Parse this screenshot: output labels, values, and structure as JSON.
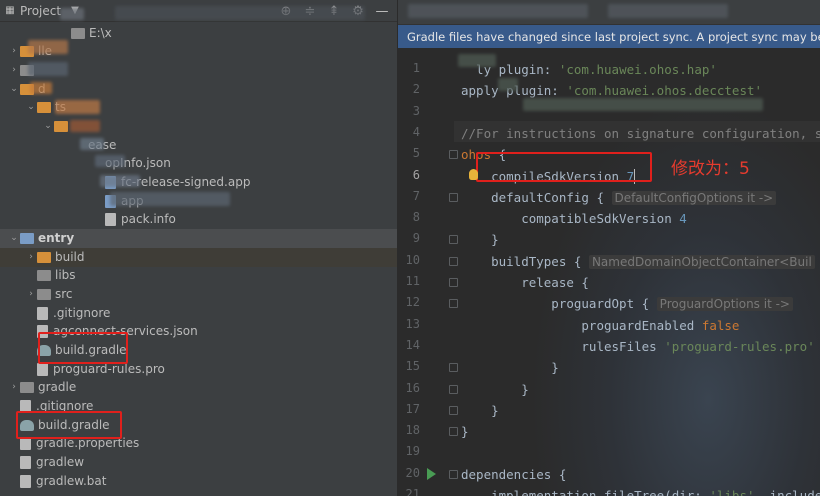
{
  "project_panel": {
    "title": "Project",
    "tools": [
      {
        "name": "locate-icon",
        "glyph": "⊕"
      },
      {
        "name": "expand-all-icon",
        "glyph": "≑"
      },
      {
        "name": "collapse-all-icon",
        "glyph": "⇞"
      },
      {
        "name": "gear-icon",
        "glyph": "⚙"
      },
      {
        "name": "hide-icon",
        "glyph": "—"
      }
    ],
    "tree": [
      {
        "label": "E:\\x",
        "arrow": "",
        "icon": "folder",
        "depth": 3
      },
      {
        "label": "lle",
        "arrow": "›",
        "icon": "folder-orange",
        "depth": 0
      },
      {
        "label": "",
        "arrow": "›",
        "icon": "folder",
        "depth": 0
      },
      {
        "label": "d",
        "arrow": "⌄",
        "icon": "folder-orange",
        "depth": 0
      },
      {
        "label": "ts",
        "arrow": "⌄",
        "icon": "folder-orange",
        "depth": 1
      },
      {
        "label": "",
        "arrow": "⌄",
        "icon": "folder-orange",
        "depth": 2
      },
      {
        "label": "ease",
        "arrow": "",
        "icon": "none",
        "depth": 4
      },
      {
        "label": "opInfo.json",
        "arrow": "",
        "icon": "none",
        "depth": 5
      },
      {
        "label": "fc-release-signed.app",
        "arrow": "",
        "icon": "app",
        "depth": 5
      },
      {
        "label": "app",
        "arrow": "",
        "icon": "app",
        "depth": 5
      },
      {
        "label": "pack.info",
        "arrow": "",
        "icon": "file",
        "depth": 5
      },
      {
        "label": "entry",
        "arrow": "⌄",
        "icon": "folder-blue",
        "depth": 0,
        "bold": true
      },
      {
        "label": "build",
        "arrow": "›",
        "icon": "folder-orange",
        "depth": 1
      },
      {
        "label": "libs",
        "arrow": "",
        "icon": "folder",
        "depth": 1
      },
      {
        "label": "src",
        "arrow": "›",
        "icon": "folder",
        "depth": 1
      },
      {
        "label": ".gitignore",
        "arrow": "",
        "icon": "file",
        "depth": 1
      },
      {
        "label": "agconnect-services.json",
        "arrow": "",
        "icon": "file",
        "depth": 1
      },
      {
        "label": "build.gradle",
        "arrow": "",
        "icon": "gradle",
        "depth": 1
      },
      {
        "label": "proguard-rules.pro",
        "arrow": "",
        "icon": "file",
        "depth": 1
      },
      {
        "label": "gradle",
        "arrow": "›",
        "icon": "folder",
        "depth": 0
      },
      {
        "label": ".gitignore",
        "arrow": "",
        "icon": "file",
        "depth": 0
      },
      {
        "label": "build.gradle",
        "arrow": "",
        "icon": "gradle",
        "depth": 0
      },
      {
        "label": "gradle.properties",
        "arrow": "",
        "icon": "file",
        "depth": 0
      },
      {
        "label": "gradlew",
        "arrow": "",
        "icon": "file",
        "depth": 0
      },
      {
        "label": "gradlew.bat",
        "arrow": "",
        "icon": "file",
        "depth": 0
      }
    ]
  },
  "editor": {
    "notice": "Gradle files have changed since last project sync. A project sync may be nece",
    "lines": [
      {
        "n": "1",
        "tokens": [
          [
            "plain",
            "  ly "
          ],
          [
            "plain",
            "plugin: "
          ],
          [
            "str",
            "'com.huawei.ohos.hap'"
          ]
        ]
      },
      {
        "n": "2",
        "tokens": [
          [
            "plain",
            "apply plugin: "
          ],
          [
            "str",
            "'com.huawei.ohos.decctest'"
          ]
        ]
      },
      {
        "n": "3",
        "tokens": [
          [
            "plain",
            ""
          ]
        ]
      },
      {
        "n": "4",
        "tokens": [
          [
            "cmt",
            "//For instructions on signature configuration, se"
          ]
        ]
      },
      {
        "n": "5",
        "tokens": [
          [
            "kw",
            "ohos"
          ],
          [
            "plain",
            " {"
          ]
        ]
      },
      {
        "n": "6",
        "tokens": [
          [
            "plain",
            "    compileSdkVersion "
          ],
          [
            "num",
            "7"
          ]
        ]
      },
      {
        "n": "7",
        "tokens": [
          [
            "plain",
            "    defaultConfig { "
          ],
          [
            "hint",
            "DefaultConfigOptions it ->"
          ]
        ]
      },
      {
        "n": "8",
        "tokens": [
          [
            "plain",
            "        compatibleSdkVersion "
          ],
          [
            "num",
            "4"
          ]
        ]
      },
      {
        "n": "9",
        "tokens": [
          [
            "plain",
            "    }"
          ]
        ]
      },
      {
        "n": "10",
        "tokens": [
          [
            "plain",
            "    buildTypes { "
          ],
          [
            "hint",
            "NamedDomainObjectContainer<Buil"
          ]
        ]
      },
      {
        "n": "11",
        "tokens": [
          [
            "plain",
            "        release {"
          ]
        ]
      },
      {
        "n": "12",
        "tokens": [
          [
            "plain",
            "            proguardOpt { "
          ],
          [
            "hint",
            "ProguardOptions it ->"
          ]
        ]
      },
      {
        "n": "13",
        "tokens": [
          [
            "plain",
            "                proguardEnabled "
          ],
          [
            "kw",
            "false"
          ]
        ]
      },
      {
        "n": "14",
        "tokens": [
          [
            "plain",
            "                rulesFiles "
          ],
          [
            "str",
            "'proguard-rules.pro'"
          ]
        ]
      },
      {
        "n": "15",
        "tokens": [
          [
            "plain",
            "            }"
          ]
        ]
      },
      {
        "n": "16",
        "tokens": [
          [
            "plain",
            "        }"
          ]
        ]
      },
      {
        "n": "17",
        "tokens": [
          [
            "plain",
            "    }"
          ]
        ]
      },
      {
        "n": "18",
        "tokens": [
          [
            "plain",
            "}"
          ]
        ]
      },
      {
        "n": "19",
        "tokens": [
          [
            "plain",
            ""
          ]
        ]
      },
      {
        "n": "20",
        "tokens": [
          [
            "plain",
            "dependencies {"
          ]
        ]
      },
      {
        "n": "21",
        "tokens": [
          [
            "plain",
            "    implementation fileTree("
          ],
          [
            "plain",
            "dir: "
          ],
          [
            "str",
            "'libs'"
          ],
          [
            "plain",
            ", include"
          ]
        ]
      }
    ]
  },
  "annotation": {
    "text": "修改为：5",
    "color": "#e53b2e"
  }
}
